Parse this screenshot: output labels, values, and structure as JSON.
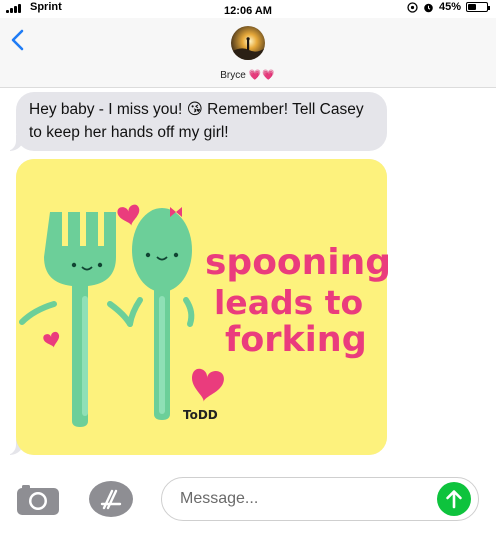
{
  "status_bar": {
    "carrier": "Sprint",
    "time": "12:06 AM",
    "battery": "45%",
    "battery_level": 0.45
  },
  "header": {
    "contact_name": "Bryce",
    "contact_hearts": "💗💗",
    "icons": [
      "chevron-left-icon",
      "avatar"
    ]
  },
  "messages": [
    {
      "type": "text",
      "text_before": "Hey baby - I miss you!",
      "emoji": "😘",
      "text_after": "Remember! Tell Casey to keep her hands off my girl!"
    },
    {
      "type": "image",
      "sticker": {
        "lines": [
          "spooning",
          "leads to",
          "forking"
        ],
        "signature": "ToDD",
        "colors": {
          "background": "#fdf27d",
          "utensil": "#6ccf99",
          "text": "#ea3c7d",
          "hearts": "#ea3c7d"
        }
      }
    }
  ],
  "toolbar": {
    "message_placeholder": "Message...",
    "icons": [
      "camera-icon",
      "app-store-icon",
      "send-arrow-icon"
    ],
    "send_color": "#0ec33d"
  }
}
